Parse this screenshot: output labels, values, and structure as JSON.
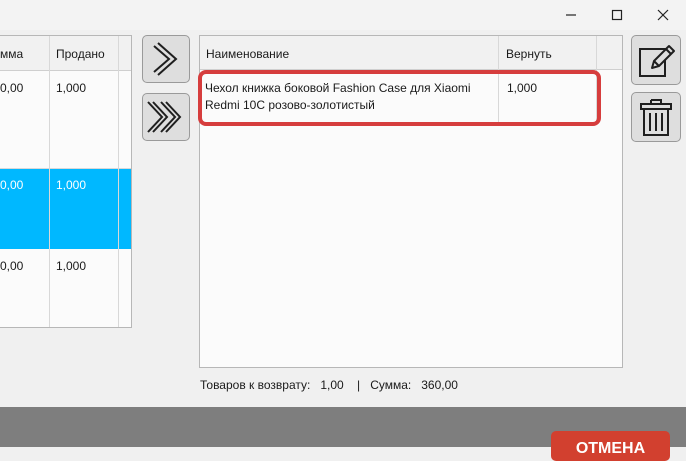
{
  "left_table": {
    "headers": [
      "мма",
      "Продано"
    ],
    "rows": [
      {
        "sum": "0,00",
        "sold": "1,000",
        "selected": false
      },
      {
        "sum": "0,00",
        "sold": "1,000",
        "selected": true
      },
      {
        "sum": "0,00",
        "sold": "1,000",
        "selected": false
      }
    ]
  },
  "return_table": {
    "headers": {
      "name": "Наименование",
      "return": "Вернуть"
    },
    "rows": [
      {
        "name_line1": "Чехол книжка боковой Fashion Case для Xiaomi",
        "name_line2": "Redmi 10C розово-золотистый",
        "return_qty": "1,000"
      }
    ]
  },
  "status": {
    "items_label": "Товаров к возврату:",
    "items_value": "1,00",
    "separator": "|",
    "sum_label": "Сумма:",
    "sum_value": "360,00"
  },
  "footer": {
    "cancel_label": "ОТМЕНА"
  },
  "colors": {
    "selected_row": "#00b8ff",
    "highlight": "#d63d3d",
    "cancel": "#d2402f"
  },
  "icons": [
    "minimize-icon",
    "maximize-icon",
    "close-icon",
    "chevron-right-icon",
    "double-chevron-right-icon",
    "edit-icon",
    "trash-icon"
  ]
}
